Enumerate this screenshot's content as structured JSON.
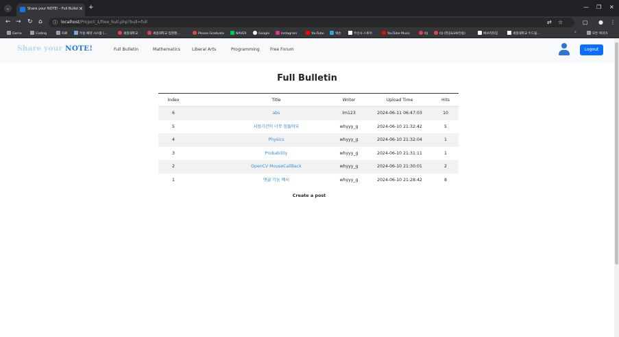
{
  "browser": {
    "tab_title": "Share your NOTE! - Full Bulleti",
    "url_host": "localhost",
    "url_path": "/Project_1/free_bull.php?bull=full",
    "bookmarks": [
      {
        "label": "Game",
        "color": "#9aa0a6"
      },
      {
        "label": "Coding",
        "color": "#9aa0a6"
      },
      {
        "label": "자료",
        "color": "#9aa0a6"
      },
      {
        "label": "무용 예약 시스템 (...",
        "color": "#7aa6e0"
      },
      {
        "label": "세종대학교",
        "color": "#e0434e"
      },
      {
        "label": "세종대학교 입현행...",
        "color": "#e0434e"
      },
      {
        "label": "Please Graduate",
        "color": "#e0434e"
      },
      {
        "label": "NAVER",
        "color": "#03c75a"
      },
      {
        "label": "Google",
        "color": "#ffffff"
      },
      {
        "label": "Instagram",
        "color": "#d8358a"
      },
      {
        "label": "YouTube",
        "color": "#ff0000"
      },
      {
        "label": "넥슨",
        "color": "#2aa7e0"
      },
      {
        "label": "무신사 스토어",
        "color": "#ffffff"
      },
      {
        "label": "YouTube Music",
        "color": "#ff0000"
      },
      {
        "label": "OJ",
        "color": "#e0434e"
      },
      {
        "label": "OJ (한공&SW전용)",
        "color": "#e0434e"
      },
      {
        "label": "에브리타임",
        "color": "#ffffff"
      },
      {
        "label": "세종대학교 두드림...",
        "color": "#ffffff"
      }
    ],
    "all_bookmarks": "모든 북마크"
  },
  "navbar": {
    "brand_main": "Share your ",
    "brand_em": "NOTE!",
    "links": [
      "Full Bulletin",
      "Mathematics",
      "Liberal Arts",
      "Programming",
      "Free Forum"
    ],
    "logout_label": "Logout",
    "accent": "#0d6efd"
  },
  "page_title": "Full Bulletin",
  "table": {
    "headers": {
      "index": "Index",
      "title": "Title",
      "writer": "Writer",
      "time": "Upload Time",
      "hits": "Hits"
    },
    "rows": [
      {
        "index": "6",
        "title": "abs",
        "writer": "lm123",
        "time": "2024-06-11 06:47:03",
        "hits": "10"
      },
      {
        "index": "5",
        "title": "시험기간이 너무 힘들어요",
        "writer": "whyyy_g",
        "time": "2024-06-10 21:32:42",
        "hits": "5"
      },
      {
        "index": "4",
        "title": "Physics",
        "writer": "whyyy_g",
        "time": "2024-06-10 21:32:04",
        "hits": "1"
      },
      {
        "index": "3",
        "title": "Probability",
        "writer": "whyyy_g",
        "time": "2024-06-10 21:31:11",
        "hits": "1"
      },
      {
        "index": "2",
        "title": "OpenCV MouseCallBack",
        "writer": "whyyy_g",
        "time": "2024-06-10 21:30:01",
        "hits": "2"
      },
      {
        "index": "1",
        "title": "댓글 기능 예시",
        "writer": "whyyy_g",
        "time": "2024-06-10 21:28:42",
        "hits": "8"
      }
    ]
  },
  "create_post_label": "Create a post"
}
